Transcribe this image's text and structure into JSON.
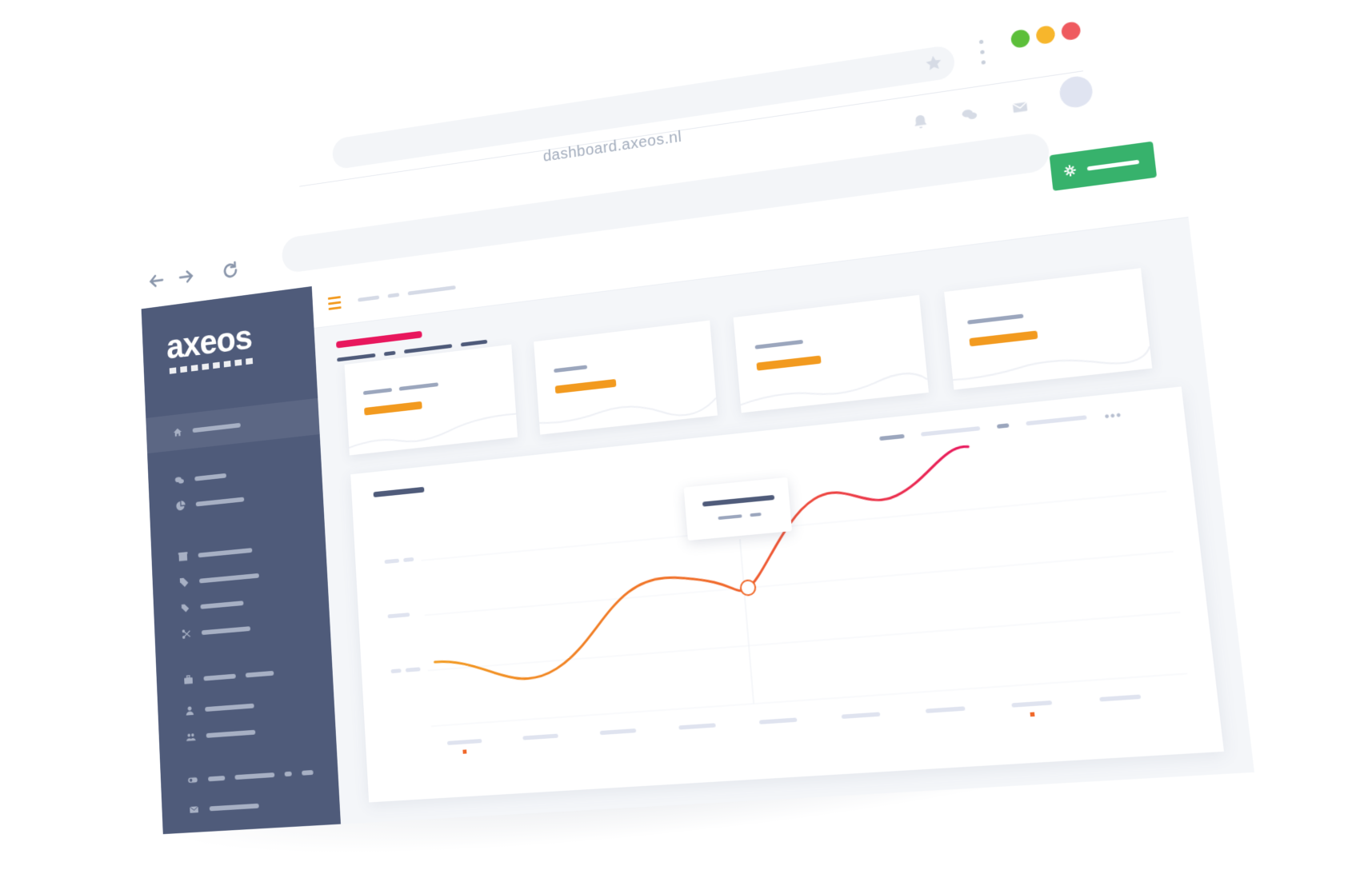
{
  "browser": {
    "url": "dashboard.axeos.nl",
    "traffic_lights": [
      "#5cbf3a",
      "#f7b62c",
      "#ef5a5f"
    ]
  },
  "sidebar": {
    "logo": "axeos",
    "items": [
      {
        "icon": "home-icon"
      },
      {
        "icon": "chat-icon"
      },
      {
        "icon": "pie-chart-icon"
      },
      {
        "icon": "box-icon"
      },
      {
        "icon": "tags-icon"
      },
      {
        "icon": "tag-icon"
      },
      {
        "icon": "scissors-icon"
      },
      {
        "icon": "briefcase-icon"
      },
      {
        "icon": "user-icon"
      },
      {
        "icon": "users-icon"
      },
      {
        "icon": "toggle-icon"
      },
      {
        "icon": "mail-icon"
      }
    ]
  },
  "header": {
    "icons": [
      "bell-icon",
      "chat-icon",
      "mail-icon"
    ]
  },
  "colors": {
    "sidebar": "#4f5b7a",
    "accent_orange": "#f29a1f",
    "accent_pink": "#e8175d",
    "success_green": "#37b26c"
  }
}
